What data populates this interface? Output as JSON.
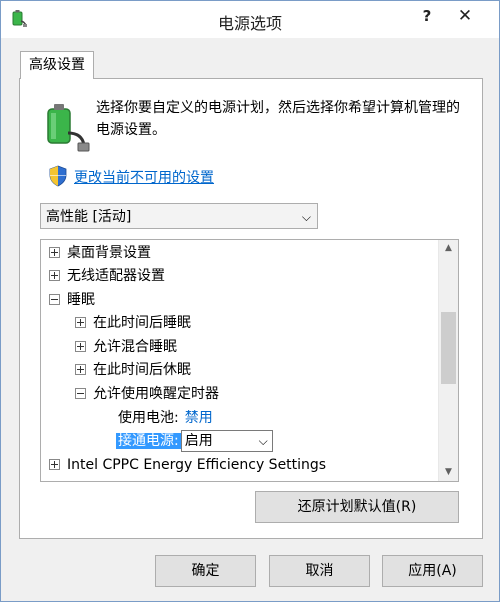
{
  "window": {
    "title": "电源选项",
    "help_label": "?",
    "close_label": "✕"
  },
  "tab": {
    "label": "高级设置"
  },
  "intro": {
    "text": "选择你要自定义的电源计划，然后选择你希望计算机管理的电源设置。"
  },
  "change_link": "更改当前不可用的设置",
  "plan_select": {
    "value": "高性能 [活动]"
  },
  "tree": {
    "desktop_bg": "桌面背景设置",
    "wireless": "无线适配器设置",
    "sleep": "睡眠",
    "sleep_after": "在此时间后睡眠",
    "hybrid_sleep": "允许混合睡眠",
    "hibernate_after": "在此时间后休眠",
    "wake_timers": "允许使用唤醒定时器",
    "on_battery_label": "使用电池:",
    "on_battery_value": "禁用",
    "plugged_in_label": "接通电源:",
    "plugged_in_value": "启用",
    "intel_cppc": "Intel CPPC Energy Efficiency Settings"
  },
  "buttons": {
    "restore": "还原计划默认值(R)",
    "ok": "确定",
    "cancel": "取消",
    "apply": "应用(A)"
  },
  "colors": {
    "link": "#0066cc",
    "highlight": "#3399ff",
    "battery_green": "#3bb54a"
  },
  "icons": {
    "app": "power-options-icon",
    "battery": "battery-plug-icon",
    "shield": "uac-shield-icon"
  }
}
